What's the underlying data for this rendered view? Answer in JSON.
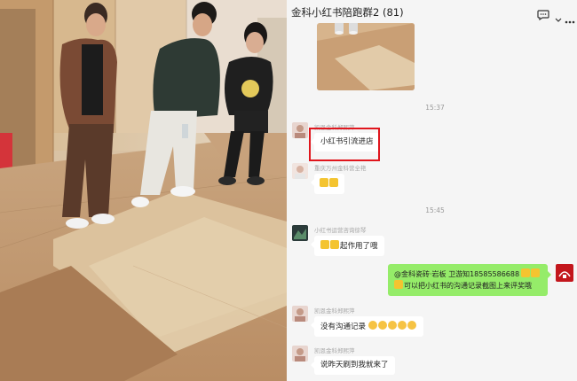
{
  "chat": {
    "title": "金科小红书陪跑群2 (81)",
    "header_icons": [
      "chat-bubble-icon",
      "more-icon"
    ],
    "messages": [
      {
        "type": "image",
        "sender": "self-or-other",
        "description": "photo"
      },
      {
        "type": "timestamp",
        "text": "15:37"
      },
      {
        "type": "text",
        "sender": "凯恩金科郑熙萍",
        "text": "小红书引流进店",
        "highlighted": true
      },
      {
        "type": "emoji",
        "sender": "重庆万州金科营全艳",
        "text": ""
      },
      {
        "type": "timestamp",
        "text": "15:45"
      },
      {
        "type": "text",
        "sender": "小红书运营咨询徐琴",
        "text": "起作用了哦"
      },
      {
        "type": "text",
        "sender": "self",
        "text_line1": "@金科瓷砖·岩板 卫游知18585586688",
        "text_line2": "可以把小红书的沟通记录截图上来评奖哦"
      },
      {
        "type": "text",
        "sender": "凯恩金科郑熙萍",
        "text": "没有沟通记录"
      },
      {
        "type": "text",
        "sender": "凯恩金科郑熙萍",
        "text": "说昨天刷到我就来了"
      }
    ]
  },
  "colors": {
    "chat_bg": "#f5f5f5",
    "self_bubble": "#95ec69",
    "highlight_box": "#e0161d"
  }
}
